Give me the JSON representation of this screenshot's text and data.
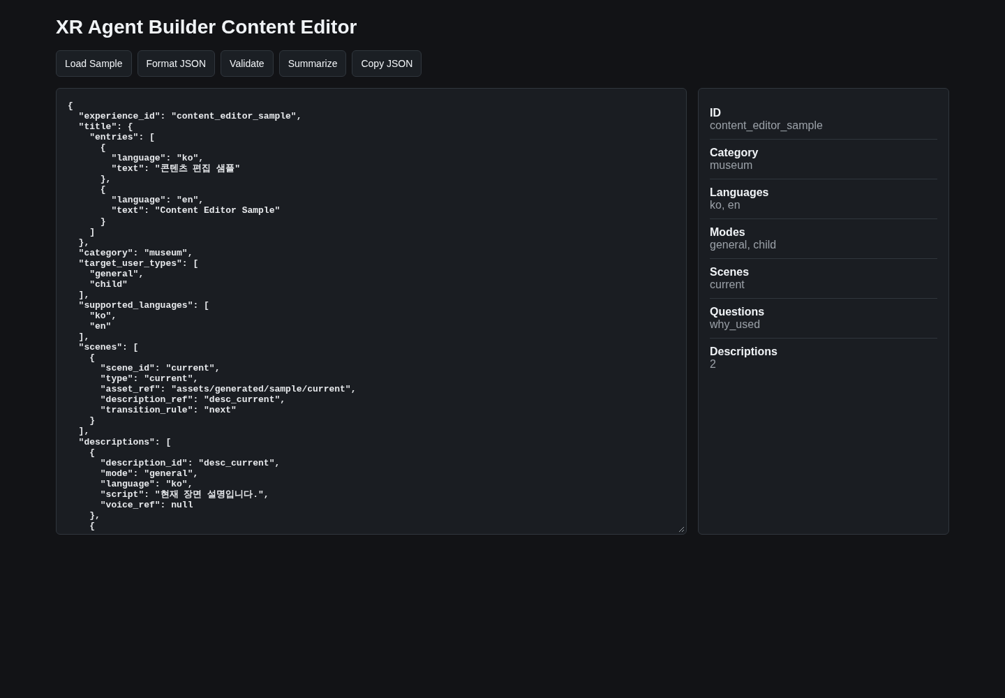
{
  "title": "XR Agent Builder Content Editor",
  "toolbar": {
    "buttons": [
      "Load Sample",
      "Format JSON",
      "Validate",
      "Summarize",
      "Copy JSON"
    ]
  },
  "editor": {
    "lines": [
      "{",
      "  \"experience_id\": \"content_editor_sample\",",
      "  \"title\": {",
      "    \"entries\": [",
      "      {",
      "        \"language\": \"ko\",",
      "        \"text\": \"콘텐츠 편집 샘플\"",
      "      },",
      "      {",
      "        \"language\": \"en\",",
      "        \"text\": \"Content Editor Sample\"",
      "      }",
      "    ]",
      "  },",
      "  \"category\": \"museum\",",
      "  \"target_user_types\": [",
      "    \"general\",",
      "    \"child\"",
      "  ],",
      "  \"supported_languages\": [",
      "    \"ko\",",
      "    \"en\"",
      "  ],",
      "  \"scenes\": [",
      "    {",
      "      \"scene_id\": \"current\",",
      "      \"type\": \"current\",",
      "      \"asset_ref\": \"assets/generated/sample/current\",",
      "      \"description_ref\": \"desc_current\",",
      "      \"transition_rule\": \"next\"",
      "    }",
      "  ],",
      "  \"descriptions\": [",
      "    {",
      "      \"description_id\": \"desc_current\",",
      "      \"mode\": \"general\",",
      "      \"language\": \"ko\",",
      "      \"script\": \"현재 장면 설명입니다.\",",
      "      \"voice_ref\": null",
      "    },",
      "    {"
    ]
  },
  "summary": {
    "items": [
      {
        "label": "ID",
        "value": "content_editor_sample"
      },
      {
        "label": "Category",
        "value": "museum"
      },
      {
        "label": "Languages",
        "value": "ko, en"
      },
      {
        "label": "Modes",
        "value": "general, child"
      },
      {
        "label": "Scenes",
        "value": "current"
      },
      {
        "label": "Questions",
        "value": "why_used"
      },
      {
        "label": "Descriptions",
        "value": "2"
      }
    ]
  }
}
